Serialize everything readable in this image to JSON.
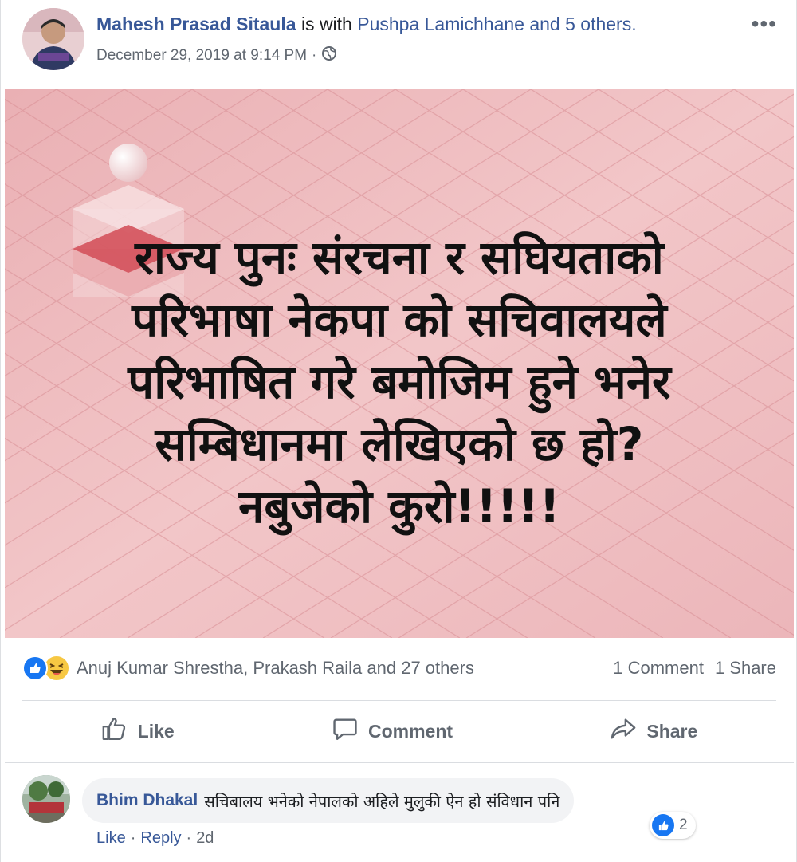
{
  "post": {
    "author": "Mahesh Prasad Sitaula",
    "with_text": "is with",
    "tagged": "Pushpa Lamichhane and 5 others.",
    "timestamp": "December 29, 2019 at 9:14 PM",
    "separator": "·",
    "privacy_icon": "globe-icon",
    "more_label": "•••",
    "image_text_lines": [
      "राज्य पुनः संरचना र सघियताको",
      "परिभाषा नेकपा को सचिवालयले",
      "परिभाषित गरे बमोजिम हुने भनेर",
      "सम्बिधानमा लेखिएको छ हो?",
      "नबुजेको कुरो!!!!!"
    ]
  },
  "reactions": {
    "icons": [
      "like-icon",
      "haha-icon"
    ],
    "summary": "Anuj Kumar Shrestha, Prakash Raila and 27 others",
    "comments_count": "1 Comment",
    "shares_count": "1 Share"
  },
  "actions": {
    "like": "Like",
    "comment": "Comment",
    "share": "Share"
  },
  "comment": {
    "author": "Bhim Dhakal",
    "text": "सचिबालय भनेको नेपालको अहिले मुलुकी ऐन हो संविधान पनि",
    "reaction_count": "2",
    "like": "Like",
    "reply": "Reply",
    "dot": "·",
    "age": "2d"
  },
  "colors": {
    "link": "#385898",
    "like_blue": "#1877f2",
    "image_bg": "#eeb8bb"
  }
}
